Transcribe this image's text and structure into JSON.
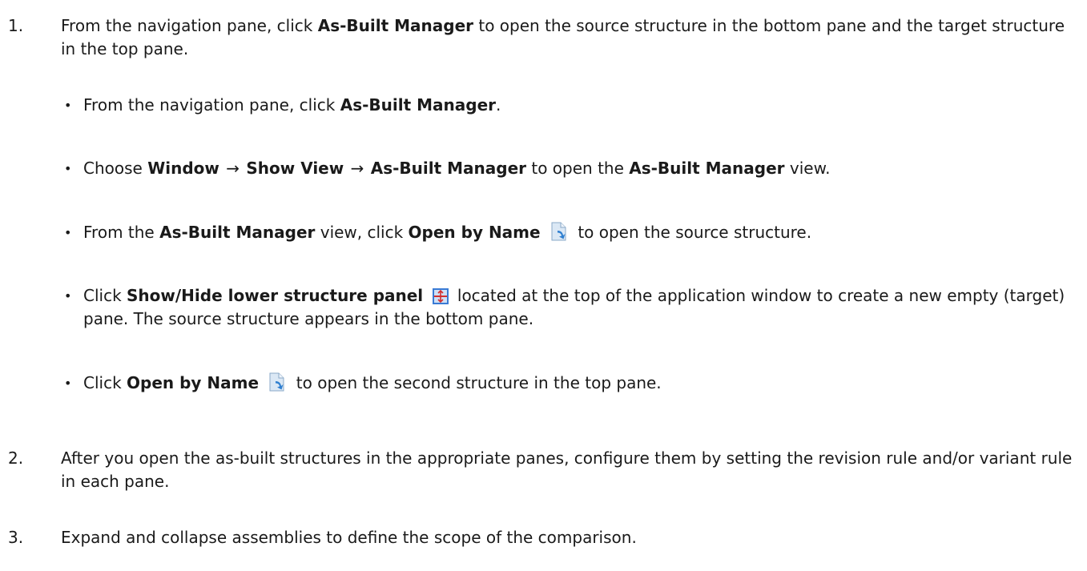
{
  "steps": [
    {
      "num": "1.",
      "t1": "From the navigation pane, click ",
      "b1": "As-Built Manager",
      "t2": " to open the source structure in the bottom pane and the target structure in the top pane."
    },
    {
      "num": "2.",
      "text": "After you open the as-built structures in the appropriate panes, configure them by setting the revision rule and/or variant rule in each pane."
    },
    {
      "num": "3.",
      "text": "Expand and collapse assemblies to define the scope of the comparison."
    }
  ],
  "bullets": [
    {
      "t1": "From the navigation pane, click ",
      "b1": "As-Built Manager",
      "t2": "."
    },
    {
      "t1": "Choose ",
      "b1": "Window",
      "arrow1": "→",
      "b2": "Show View",
      "arrow2": "→",
      "b3": "As-Built Manager",
      "t2": " to open the ",
      "b4": "As-Built Manager",
      "t3": " view."
    },
    {
      "t1": "From the ",
      "b1": "As-Built Manager",
      "t2": " view, click ",
      "b2": "Open by Name",
      "icon": "open-by-name-icon",
      "t3": " to open the source structure."
    },
    {
      "t1": "Click ",
      "b1": "Show/Hide lower structure panel",
      "icon": "show-hide-lower-panel-icon",
      "t2": " located at the top of the application window to create a new empty (target) pane. The source structure appears in the bottom pane."
    },
    {
      "t1": "Click ",
      "b1": "Open by Name",
      "icon": "open-by-name-icon",
      "t2": " to open the second structure in the top pane."
    }
  ],
  "bullet_glyph": "•",
  "colors": {
    "text": "#1a1a1a",
    "icon_page": "#dbe8f5",
    "icon_arrow": "#2f7fd0",
    "icon_panel_red": "#d32f2f",
    "icon_panel_blue": "#3a7bd5"
  }
}
